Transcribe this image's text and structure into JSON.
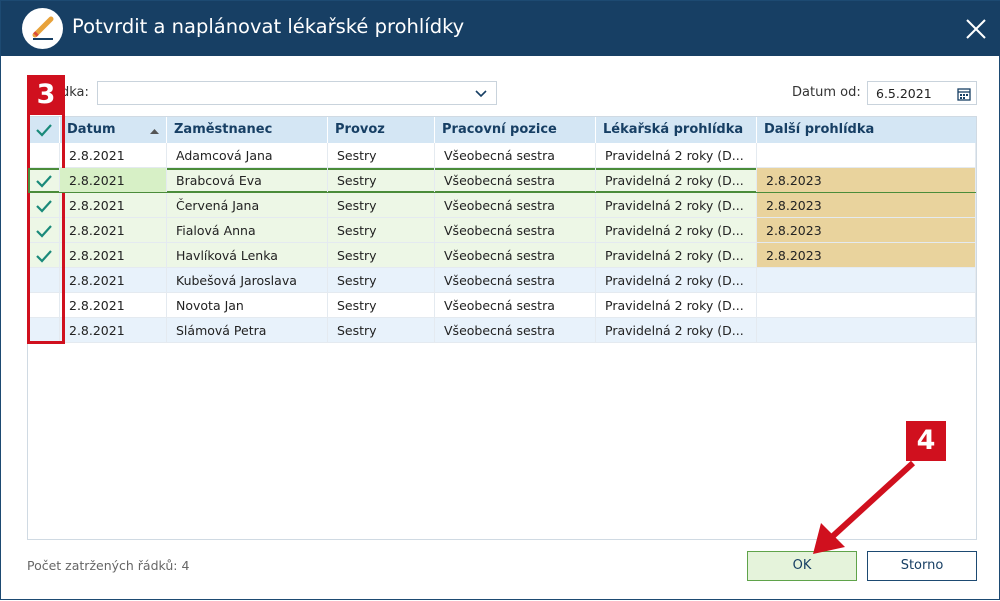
{
  "window": {
    "title": "Potvrdit a naplánovat lékařské prohlídky",
    "icon": "pencil-icon",
    "close_icon": "close-icon"
  },
  "filter": {
    "label": "dka:",
    "value": ""
  },
  "date_from": {
    "label": "Datum od:",
    "value": "6.5.2021",
    "icon": "calendar-icon"
  },
  "grid": {
    "columns": [
      "",
      "Datum",
      "Zaměstnanec",
      "Provoz",
      "Pracovní pozice",
      "Lékařská prohlídka",
      "Další prohlídka"
    ],
    "sort_column": "Datum",
    "sort_direction": "ascending",
    "rows": [
      {
        "checked": false,
        "date": "2.8.2021",
        "employee": "Adamcová Jana",
        "operation": "Sestry",
        "position": "Všeobecná sestra",
        "exam": "Pravidelná 2 roky (D...",
        "next": ""
      },
      {
        "checked": true,
        "date": "2.8.2021",
        "employee": "Brabcová Eva",
        "operation": "Sestry",
        "position": "Všeobecná sestra",
        "exam": "Pravidelná 2 roky (D...",
        "next": "2.8.2023"
      },
      {
        "checked": true,
        "date": "2.8.2021",
        "employee": "Červená Jana",
        "operation": "Sestry",
        "position": "Všeobecná sestra",
        "exam": "Pravidelná 2 roky (D...",
        "next": "2.8.2023"
      },
      {
        "checked": true,
        "date": "2.8.2021",
        "employee": "Fialová Anna",
        "operation": "Sestry",
        "position": "Všeobecná sestra",
        "exam": "Pravidelná 2 roky (D...",
        "next": "2.8.2023"
      },
      {
        "checked": true,
        "date": "2.8.2021",
        "employee": "Havlíková Lenka",
        "operation": "Sestry",
        "position": "Všeobecná sestra",
        "exam": "Pravidelná 2 roky (D...",
        "next": "2.8.2023"
      },
      {
        "checked": false,
        "date": "2.8.2021",
        "employee": "Kubešová Jaroslava",
        "operation": "Sestry",
        "position": "Všeobecná sestra",
        "exam": "Pravidelná 2 roky (D...",
        "next": ""
      },
      {
        "checked": false,
        "date": "2.8.2021",
        "employee": "Novota Jan",
        "operation": "Sestry",
        "position": "Všeobecná sestra",
        "exam": "Pravidelná 2 roky (D...",
        "next": ""
      },
      {
        "checked": false,
        "date": "2.8.2021",
        "employee": "Slámová Petra",
        "operation": "Sestry",
        "position": "Všeobecná sestra",
        "exam": "Pravidelná 2 roky (D...",
        "next": ""
      }
    ]
  },
  "footer": {
    "count_text": "Počet zatržených řádků: 4",
    "ok_label": "OK",
    "cancel_label": "Storno"
  },
  "annotations": {
    "step_3": "3",
    "step_4": "4",
    "color": "#d0101e"
  },
  "colors": {
    "titlebar": "#173f64",
    "header": "#d4e6f4",
    "check": "#1a8a7a",
    "next_exam_fill": "#e9d39d",
    "selected_row_border": "#4a8c3a"
  }
}
